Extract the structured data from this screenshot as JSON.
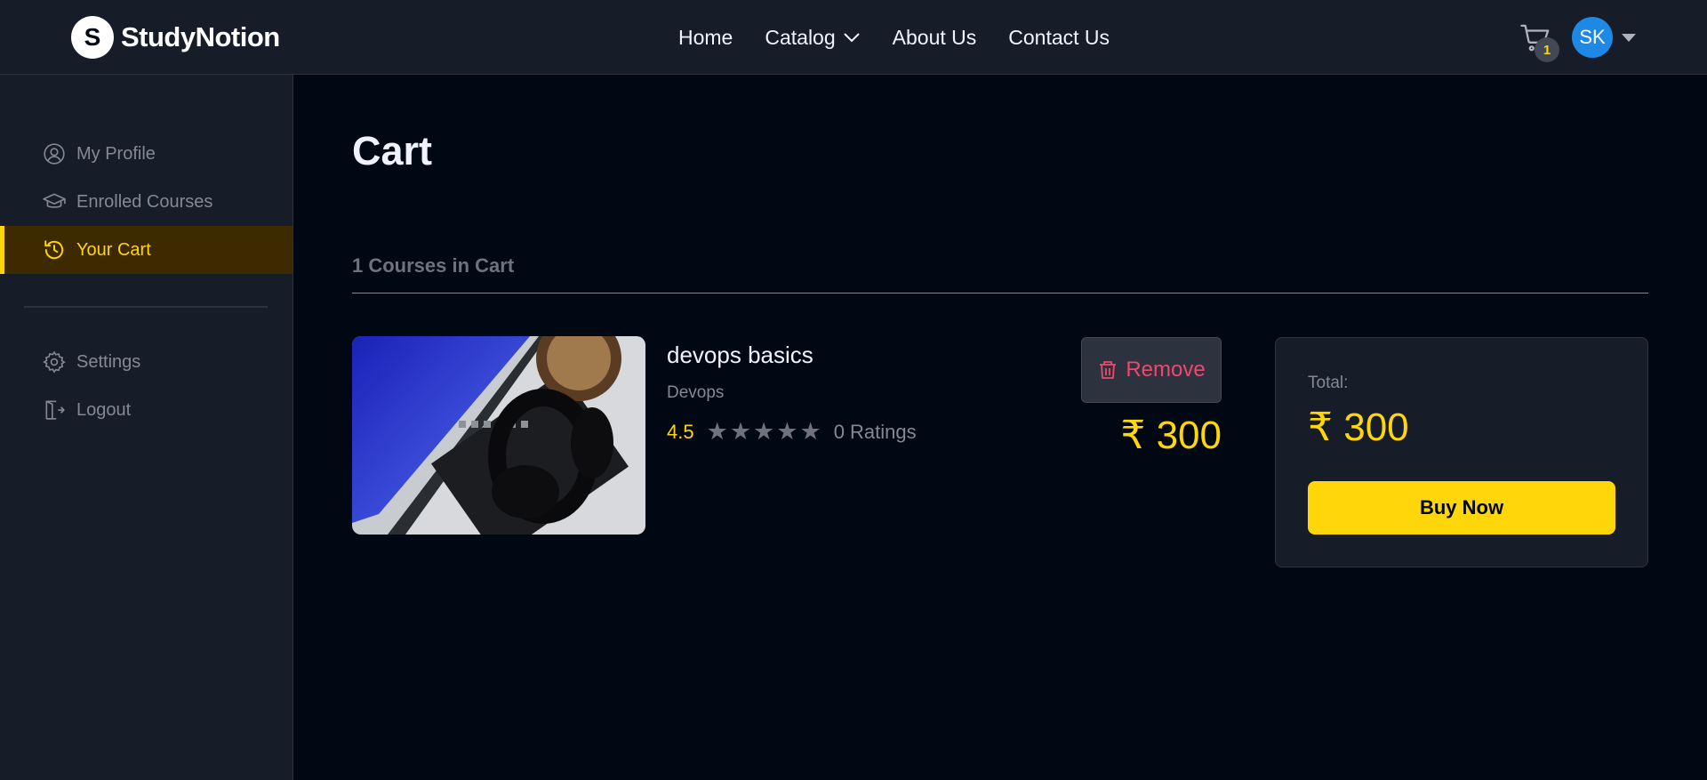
{
  "brand": {
    "name": "StudyNotion",
    "logo_letter": "S"
  },
  "nav": {
    "links": [
      {
        "label": "Home"
      },
      {
        "label": "Catalog",
        "has_dropdown": true
      },
      {
        "label": "About Us"
      },
      {
        "label": "Contact Us"
      }
    ],
    "cart_count": "1",
    "avatar_initials": "SK"
  },
  "sidebar": {
    "items": [
      {
        "label": "My Profile",
        "icon": "user-circle-icon"
      },
      {
        "label": "Enrolled Courses",
        "icon": "graduation-cap-icon"
      },
      {
        "label": "Your Cart",
        "icon": "history-icon",
        "active": true
      }
    ],
    "bottom_items": [
      {
        "label": "Settings",
        "icon": "gear-icon"
      },
      {
        "label": "Logout",
        "icon": "logout-icon"
      }
    ]
  },
  "page": {
    "title": "Cart",
    "count_heading": "1 Courses in Cart"
  },
  "course": {
    "name": "devops basics",
    "category": "Devops",
    "rating": "4.5",
    "stars_filled": 0,
    "stars_total": 5,
    "ratings_count": "0 Ratings",
    "remove_label": "Remove",
    "price": "₹ 300"
  },
  "summary": {
    "total_label": "Total:",
    "total_value": "₹ 300",
    "buy_label": "Buy Now"
  },
  "colors": {
    "accent": "#FFD60A",
    "background": "#000814",
    "panel": "#161D29",
    "danger": "#EF476F",
    "avatar": "#1E88E5"
  }
}
